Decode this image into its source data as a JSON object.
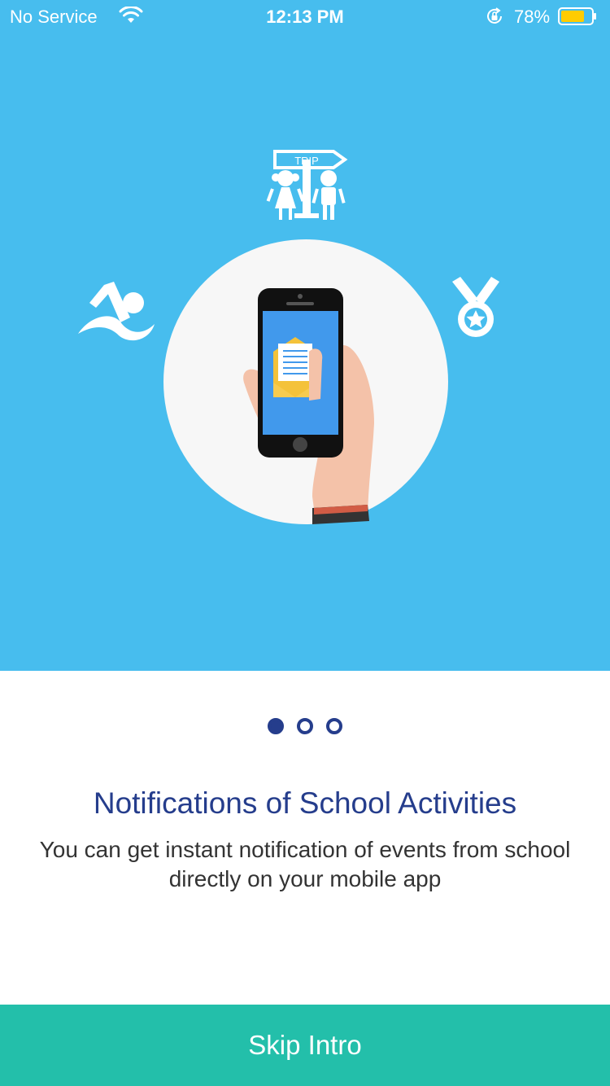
{
  "status_bar": {
    "carrier": "No Service",
    "time": "12:13 PM",
    "battery_percent": "78%",
    "battery_level": 0.78,
    "icons": [
      "wifi-icon",
      "orientation-lock-icon",
      "battery-icon"
    ]
  },
  "illustration": {
    "trip_sign_text": "TRIP",
    "icons": [
      "trip-kids-icon",
      "swimmer-icon",
      "medal-icon",
      "hand-phone-icon",
      "envelope-icon"
    ]
  },
  "pager": {
    "count": 3,
    "active_index": 0
  },
  "content": {
    "title": "Notifications of School Activities",
    "description": "You can get instant notification of events from school directly on your mobile app"
  },
  "skip_button": {
    "label": "Skip Intro"
  },
  "colors": {
    "hero_background": "#47bdee",
    "title": "#253d8c",
    "button": "#23bfaa",
    "battery": "#ffcc00"
  }
}
